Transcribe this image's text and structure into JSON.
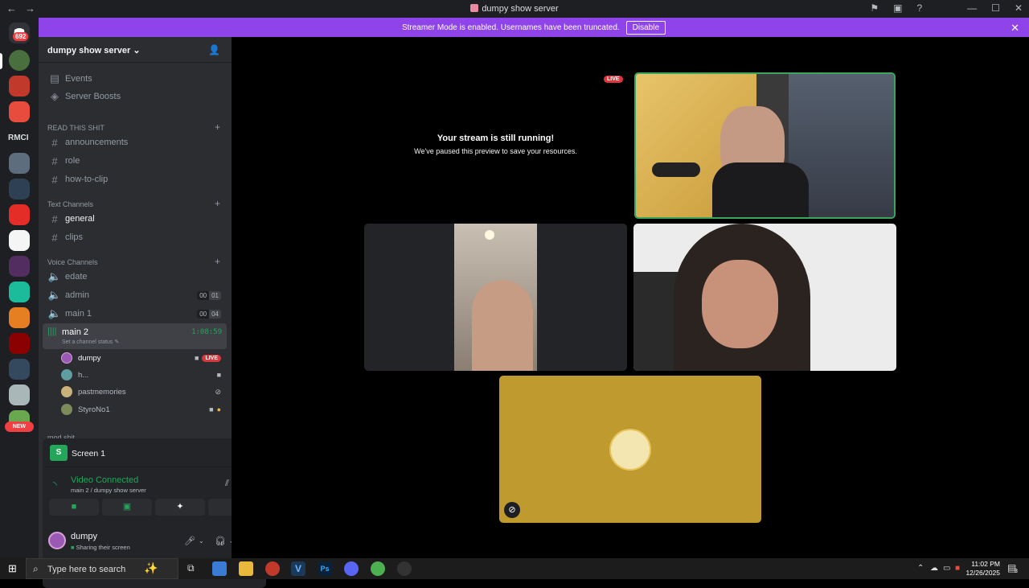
{
  "window": {
    "title": "dumpy show server"
  },
  "banner": {
    "text": "Streamer Mode is enabled. Usernames have been truncated.",
    "button": "Disable"
  },
  "guilds": {
    "mention_count": "692",
    "rmci_label": "RMCI",
    "new_badge": "NEW"
  },
  "server": {
    "name": "dumpy show server"
  },
  "channel_list": {
    "events": "Events",
    "boosts": "Server Boosts",
    "cat_read": "READ THIS SHIT",
    "announcements": "announcements",
    "role": "role",
    "how_to_clip": "how-to-clip",
    "cat_text": "Text Channels",
    "general": "general",
    "clips": "clips",
    "cat_voice": "Voice Channels",
    "edate": "edate",
    "admin": "admin",
    "admin_count": "00",
    "admin_limit": "01",
    "main1": "main 1",
    "main1_count": "00",
    "main1_limit": "04",
    "main2": "main 2",
    "main2_time": "1:08:59",
    "main2_status": "Set a channel status",
    "voice_users": [
      {
        "name": "dumpy",
        "live": "LIVE"
      },
      {
        "name": "h..."
      },
      {
        "name": "pastmemories"
      },
      {
        "name": "StyroNo1"
      }
    ],
    "cat_mod": "mod shit"
  },
  "panel": {
    "screen_label": "Screen 1",
    "connection": "Video Connected",
    "location": "main 2 / dumpy show server",
    "user_name": "dumpy",
    "user_status": "Sharing their screen"
  },
  "stage": {
    "live_badge": "LIVE",
    "paused_title": "Your stream is still running!",
    "paused_sub": "We've paused this preview to save your resources."
  },
  "taskbar": {
    "search_placeholder": "Type here to search",
    "time": "11:02 PM",
    "date": "12/26/2025",
    "notif_count": "3"
  },
  "colors": {
    "accent": "#8e44e9",
    "green": "#23a55a",
    "red": "#da373c",
    "yellow_tile": "#bf9a2f"
  }
}
